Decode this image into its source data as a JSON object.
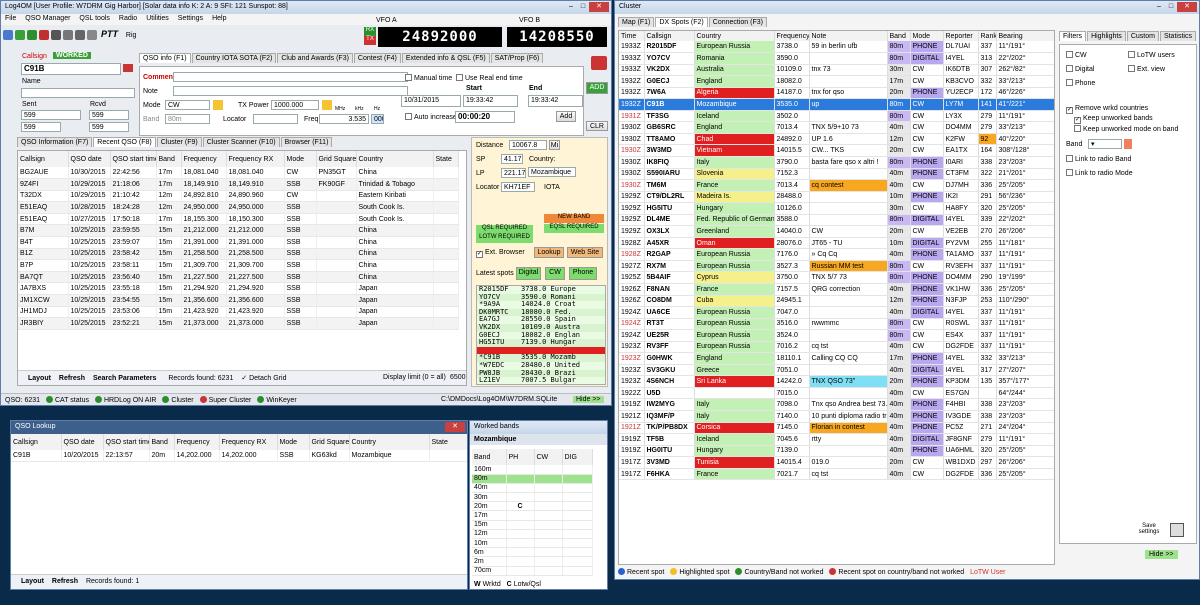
{
  "log4om": {
    "title": "Log4OM [User Profile: W7DRM Gig Harbor] [Solar data info K: 2 A: 9 SFI: 121 Sunspot: 88]",
    "menu": [
      "File",
      "QSO Manager",
      "QSL tools",
      "Radio",
      "Utilities",
      "Settings",
      "Help"
    ],
    "ptt": "PTT",
    "rig_label": "Rig",
    "vfo_a_label": "VFO A",
    "vfo_a_value": "24892000",
    "rx": "RX",
    "tx": "TX",
    "vfo_b_label": "VFO B",
    "vfo_b_value": "14208550",
    "callsign_label": "Callsign",
    "worked": "WORKED",
    "callsign_value": "C91B",
    "name_label": "Name",
    "sent_label": "Sent",
    "rcvd_label": "Rcvd",
    "sent_value": "599",
    "rcvd_value": "599",
    "sent_sel": "599",
    "rcvd_sel": "599",
    "tabs": [
      "QSO info (F1)",
      "Country IOTA SOTA (F2)",
      "Club and Awards (F3)",
      "Contest (F4)",
      "Extended info & QSL (F5)",
      "SAT/Prop (F6)"
    ],
    "comment_label": "Comment",
    "note_label": "Note",
    "mode_label": "Mode",
    "mode_value": "CW",
    "band_label": "Band",
    "band_value": "80m",
    "txpower_label": "TX Power",
    "txpower_value": "1000.000",
    "locator_label": "Locator",
    "freq_label": "Freq",
    "mhz": "MHz",
    "khz": "kHz",
    "hz": "Hz",
    "freq_mhz": "3.535",
    "freq_hz": "000",
    "manual_time": "Manual time",
    "use_real_time": "Use Real end time",
    "auto_increase": "Auto increase",
    "start": "Start",
    "end": "End",
    "date": "10/31/2015",
    "start_time": "19:33:42",
    "end_time": "19:33:42",
    "duration": "00:00:20",
    "add": "ADD",
    "add2": "Add",
    "clr": "CLR",
    "bottom_tabs": [
      "QSO Information (F7)",
      "Recent QSO (F8)",
      "Cluster (F9)",
      "Cluster Scanner (F10)",
      "Browser (F11)"
    ],
    "grid_headers": [
      "Callsign",
      "QSO date",
      "QSO start time",
      "Band",
      "Frequency",
      "Frequency RX",
      "Mode",
      "Grid Square",
      "Country",
      "State"
    ],
    "rows": [
      [
        "BG2AUE",
        "10/30/2015",
        "22:42:56",
        "17m",
        "18,081.040",
        "18,081.040",
        "CW",
        "PN35GT",
        "China",
        ""
      ],
      [
        "9Z4FI",
        "10/29/2015",
        "21:18:06",
        "17m",
        "18,149.910",
        "18,149.910",
        "SSB",
        "FK90GF",
        "Trinidad & Tobago",
        ""
      ],
      [
        "T32DX",
        "10/29/2015",
        "21:10:42",
        "12m",
        "24,892.810",
        "24,890.960",
        "CW",
        "",
        "Eastern Kiribati",
        ""
      ],
      [
        "E51EAQ",
        "10/28/2015",
        "18:24:28",
        "12m",
        "24,950.000",
        "24,950.000",
        "SSB",
        "",
        "South Cook Is.",
        ""
      ],
      [
        "E51EAQ",
        "10/27/2015",
        "17:50:18",
        "17m",
        "18,155.300",
        "18,150.300",
        "SSB",
        "",
        "South Cook Is.",
        ""
      ],
      [
        "B7M",
        "10/25/2015",
        "23:59:55",
        "15m",
        "21,212.000",
        "21,212.000",
        "SSB",
        "",
        "China",
        ""
      ],
      [
        "B4T",
        "10/25/2015",
        "23:59:07",
        "15m",
        "21,391.000",
        "21,391.000",
        "SSB",
        "",
        "China",
        ""
      ],
      [
        "B1Z",
        "10/25/2015",
        "23:58:42",
        "15m",
        "21,258.500",
        "21,258.500",
        "SSB",
        "",
        "China",
        ""
      ],
      [
        "B7P",
        "10/25/2015",
        "23:58:11",
        "15m",
        "21,309.700",
        "21,309.700",
        "SSB",
        "",
        "China",
        ""
      ],
      [
        "BA7QT",
        "10/25/2015",
        "23:56:40",
        "15m",
        "21,227.500",
        "21,227.500",
        "SSB",
        "",
        "China",
        ""
      ],
      [
        "JA7BXS",
        "10/25/2015",
        "23:55:18",
        "15m",
        "21,294.920",
        "21,294.920",
        "SSB",
        "",
        "Japan",
        ""
      ],
      [
        "JM1XCW",
        "10/25/2015",
        "23:54:55",
        "15m",
        "21,356.600",
        "21,356.600",
        "SSB",
        "",
        "Japan",
        ""
      ],
      [
        "JH1MDJ",
        "10/25/2015",
        "23:53:06",
        "15m",
        "21,423.920",
        "21,423.920",
        "SSB",
        "",
        "Japan",
        ""
      ],
      [
        "JR3BIY",
        "10/25/2015",
        "23:52:21",
        "15m",
        "21,373.000",
        "21,373.000",
        "SSB",
        "",
        "Japan",
        ""
      ]
    ],
    "footer": {
      "layout": "Layout",
      "refresh": "Refresh",
      "search": "Search Parameters",
      "records": "Records found:",
      "count": "6231",
      "detach": "Detach Grid",
      "display": "Display limit (0 = all)",
      "limit": "6500"
    },
    "info": {
      "distance_label": "Distance",
      "distance": "10067.8",
      "mi": "Mi",
      "sp_label": "SP",
      "sp": "41.17",
      "country_label": "Country:",
      "lp_label": "LP",
      "lp": "221.17",
      "country": "Mozambique",
      "locator_label": "Locator",
      "locator": "KH71EF",
      "iota": "IOTA"
    },
    "new_band": "NEW BAND",
    "eqsl_required": "EQSL REQUIRED",
    "qsl_required": "QSL REQUIRED",
    "lotw_required": "LOTW REQUIRED",
    "lookup": "Lookup",
    "website": "Web Site",
    "ext_browser": "Ext. Browser",
    "latest_spots": "Latest spots",
    "digital": "Digital",
    "cw": "CW",
    "phone": "Phone",
    "spot_list": [
      [
        "R2015DF",
        "3738.0 Europe"
      ],
      [
        "YO7CV",
        "3590.0 Romani"
      ],
      [
        "*9A9A",
        "14024.0 Croat"
      ],
      [
        "DK0MRTC",
        "18080.0 Fed."
      ],
      [
        "EA7GJ",
        "28550.0 Spain"
      ],
      [
        "VK2DX",
        "10109.0 Austra"
      ],
      [
        "G0ECJ",
        "18082.0 Englan"
      ],
      [
        "HG5ITU",
        "7139.0 Hungar"
      ],
      [
        "",
        "",
        "red"
      ],
      [
        "*C91B",
        "3535.0 Mozamb"
      ],
      [
        "*W7EDC",
        "28480.0 United"
      ],
      [
        "PW8JB",
        "28430.0 Brazi"
      ],
      [
        "LZ1EV",
        "7007.5 Bulgar"
      ]
    ],
    "status": {
      "qso": "QSO:",
      "qso_count": "6231",
      "cat": "CAT status",
      "hrd": "HRDLog ON AIR",
      "cluster": "Cluster",
      "super": "Super Cluster",
      "winkeyer": "WinKeyer",
      "path": "C:\\DMDocs\\Log4OM\\W7DRM.SQLite",
      "hide": "Hide >>"
    }
  },
  "lookup": {
    "title": "QSO Lookup",
    "headers": [
      "Callsign",
      "QSO date",
      "QSO start time",
      "Band",
      "Frequency",
      "Frequency RX",
      "Mode",
      "Grid Square",
      "Country",
      "State"
    ],
    "row": [
      "C91B",
      "10/20/2015",
      "22:13:57",
      "20m",
      "14,202.000",
      "14,202.000",
      "SSB",
      "KG63kd",
      "Mozambique",
      ""
    ],
    "layout": "Layout",
    "refresh": "Refresh",
    "records": "Records found:",
    "count": "1"
  },
  "worked": {
    "title": "Worked bands",
    "country": "Mozambique",
    "headers": [
      "Band",
      "PH",
      "CW",
      "DIG"
    ],
    "rows": [
      [
        "160m",
        "",
        "",
        ""
      ],
      [
        "80m",
        "",
        "",
        ""
      ],
      [
        "40m",
        "",
        "",
        ""
      ],
      [
        "30m",
        "",
        "",
        ""
      ],
      [
        "20m",
        "C",
        "",
        ""
      ],
      [
        "17m",
        "",
        "",
        ""
      ],
      [
        "15m",
        "",
        "",
        ""
      ],
      [
        "12m",
        "",
        "",
        ""
      ],
      [
        "10m",
        "",
        "",
        ""
      ],
      [
        "6m",
        "",
        "",
        ""
      ],
      [
        "2m",
        "",
        "",
        ""
      ],
      [
        "70cm",
        "",
        "",
        ""
      ]
    ],
    "legend_w": "W",
    "legend_w_text": "Wrktd",
    "legend_c": "C",
    "legend_c_text": "Lotw/Qsl"
  },
  "cluster": {
    "title": "Cluster",
    "tabs": [
      "Map (F1)",
      "DX Spots (F2)",
      "Connection (F3)"
    ],
    "right_tabs": [
      "Filters",
      "Highlights",
      "Custom",
      "Statistics"
    ],
    "headers": [
      "Time",
      "Callsign",
      "Country",
      "Frequency",
      "Note",
      "Band",
      "Mode",
      "Reporter",
      "Rank",
      "Bearing"
    ],
    "spots": [
      [
        "1933Z",
        "R2015DF",
        "European Russia",
        "3738.0",
        "59 in berlin ufb",
        "80m",
        "PHONE",
        "DL7UAI",
        "337",
        "11°/191°"
      ],
      [
        "1933Z",
        "YO7CV",
        "Romania",
        "3590.0",
        "",
        "80m",
        "DIGITAL",
        "I4YEL",
        "313",
        "22°/202°"
      ],
      [
        "1933Z",
        "VK2DX",
        "Australia",
        "10109.0",
        "tnx 73",
        "30m",
        "CW",
        "IK6DTB",
        "307",
        "262°/82°"
      ],
      [
        "1932Z",
        "G0ECJ",
        "England",
        "18082.0",
        "",
        "17m",
        "CW",
        "KB3CVO",
        "332",
        "33°/213°"
      ],
      [
        "1932Z",
        "7W6A",
        "Algeria",
        "14187.0",
        "tnx for qso",
        "20m",
        "PHONE",
        "YU2ECP",
        "172",
        "46°/226°"
      ],
      [
        "1932Z",
        "C91B",
        "Mozambique",
        "3535.0",
        "up",
        "80m",
        "CW",
        "LY7M",
        "141",
        "41°/221°"
      ],
      [
        "1931Z",
        "TF3SG",
        "Iceland",
        "3502.0",
        "",
        "80m",
        "CW",
        "LY3X",
        "279",
        "11°/191°"
      ],
      [
        "1930Z",
        "GB6SRC",
        "England",
        "7013.4",
        "TNX 5/9+10 73",
        "40m",
        "CW",
        "DO4MM",
        "279",
        "33°/213°"
      ],
      [
        "1930Z",
        "TT8AMO",
        "Chad",
        "24892.0",
        "UP 1.6",
        "12m",
        "CW",
        "K2FW",
        "92",
        "40°/220°"
      ],
      [
        "1930Z",
        "3W3MD",
        "Vietnam",
        "14015.5",
        "CW... TKS",
        "20m",
        "CW",
        "EA1TX",
        "164",
        "308°/128°"
      ],
      [
        "1930Z",
        "IK8FIQ",
        "Italy",
        "3790.0",
        "basta fare qso x altri !",
        "80m",
        "PHONE",
        "I0ARI",
        "338",
        "23°/203°"
      ],
      [
        "1930Z",
        "S590IARU",
        "Slovenia",
        "7152.3",
        "",
        "40m",
        "PHONE",
        "CT3FM",
        "322",
        "21°/201°"
      ],
      [
        "1930Z",
        "TM6M",
        "France",
        "7013.4",
        "cq contest",
        "40m",
        "CW",
        "DJ7MH",
        "336",
        "25°/205°"
      ],
      [
        "1929Z",
        "CT9/DL2RL",
        "Madeira Is.",
        "28488.0",
        "",
        "10m",
        "PHONE",
        "IK2I",
        "291",
        "56°/236°"
      ],
      [
        "1929Z",
        "HG5ITU",
        "Hungary",
        "10126.0",
        "",
        "30m",
        "CW",
        "HA8FY",
        "320",
        "25°/205°"
      ],
      [
        "1929Z",
        "DL4ME",
        "Fed. Republic of Germany",
        "3588.0",
        "",
        "80m",
        "DIGITAL",
        "I4YEL",
        "339",
        "22°/202°"
      ],
      [
        "1929Z",
        "OX3LX",
        "Greenland",
        "14040.0",
        "CW",
        "20m",
        "CW",
        "VE2EB",
        "270",
        "26°/206°"
      ],
      [
        "1928Z",
        "A45XR",
        "Oman",
        "28076.0",
        "JT65 - TU",
        "10m",
        "DIGITAL",
        "PY2VM",
        "255",
        "11°/181°"
      ],
      [
        "1928Z",
        "R2GAP",
        "European Russia",
        "7176.0",
        "» Cq Cq",
        "40m",
        "PHONE",
        "TA1AMO",
        "337",
        "11°/191°"
      ],
      [
        "1927Z",
        "RX7M",
        "European Russia",
        "3527.3",
        "Russian MM test",
        "80m",
        "CW",
        "RV3EFH",
        "337",
        "11°/191°"
      ],
      [
        "1925Z",
        "5B4AIF",
        "Cyprus",
        "3750.0",
        "TNX 5/7 73",
        "80m",
        "PHONE",
        "DO4MM",
        "290",
        "19°/199°"
      ],
      [
        "1926Z",
        "F8NAN",
        "France",
        "7157.5",
        "QRG correction",
        "40m",
        "PHONE",
        "VK1HW",
        "336",
        "25°/205°"
      ],
      [
        "1926Z",
        "CO8DM",
        "Cuba",
        "24945.1",
        "",
        "12m",
        "PHONE",
        "N3FJP",
        "253",
        "110°/290°"
      ],
      [
        "1924Z",
        "UA6CE",
        "European Russia",
        "7047.0",
        "",
        "40m",
        "DIGITAL",
        "I4YEL",
        "337",
        "11°/191°"
      ],
      [
        "1924Z",
        "RT3T",
        "European Russia",
        "3516.0",
        "rwwmmc",
        "80m",
        "CW",
        "R0SWL",
        "337",
        "11°/191°"
      ],
      [
        "1924Z",
        "UE25R",
        "European Russia",
        "3524.0",
        "",
        "80m",
        "CW",
        "ES4X",
        "337",
        "11°/191°"
      ],
      [
        "1923Z",
        "RV3FF",
        "European Russia",
        "7016.2",
        "cq tst",
        "40m",
        "CW",
        "DG2FDE",
        "337",
        "11°/191°"
      ],
      [
        "1923Z",
        "G0HWK",
        "England",
        "18110.1",
        "Calling CQ CQ",
        "17m",
        "PHONE",
        "I4YEL",
        "332",
        "33°/213°"
      ],
      [
        "1923Z",
        "SV3GKU",
        "Greece",
        "7051.0",
        "",
        "40m",
        "DIGITAL",
        "I4YEL",
        "317",
        "27°/207°"
      ],
      [
        "1923Z",
        "4S6NCH",
        "Sri Lanka",
        "14242.0",
        "TNX QSO 73\"",
        "20m",
        "PHONE",
        "KP3DM",
        "135",
        "357°/177°"
      ],
      [
        "1922Z",
        "U5D",
        "",
        "7015.0",
        "",
        "40m",
        "CW",
        "ES7GN",
        "",
        "64°/244°"
      ],
      [
        "1919Z",
        "IW2MYG",
        "Italy",
        "7098.0",
        "Tnx qso Andrea best 73...",
        "40m",
        "PHONE",
        "F4HBI",
        "338",
        "23°/203°"
      ],
      [
        "1921Z",
        "IQ3MF/P",
        "Italy",
        "7140.0",
        "10 punti diploma radio tr...",
        "40m",
        "PHONE",
        "IV3GDE",
        "338",
        "23°/203°"
      ],
      [
        "1921Z",
        "TK/P/PB8DX",
        "Corsica",
        "7145.0",
        "Florian in contest",
        "40m",
        "PHONE",
        "PC5Z",
        "271",
        "24°/204°"
      ],
      [
        "1919Z",
        "TF5B",
        "Iceland",
        "7045.6",
        "rtty",
        "40m",
        "DIGITAL",
        "JF8GNF",
        "279",
        "11°/191°"
      ],
      [
        "1919Z",
        "HG0ITU",
        "Hungary",
        "7139.0",
        "",
        "40m",
        "PHONE",
        "UA6HML",
        "320",
        "25°/205°"
      ],
      [
        "1917Z",
        "3V3MD",
        "Tunisia",
        "14015.4",
        "019.0",
        "20m",
        "CW",
        "WB1DXD",
        "297",
        "26°/206°"
      ],
      [
        "1917Z",
        "F6HKA",
        "France",
        "7021.7",
        "cq tst",
        "40m",
        "CW",
        "DG2FDE",
        "336",
        "25°/205°"
      ]
    ],
    "filters": {
      "cw": "CW",
      "lotw_users": "LoTW users",
      "digital": "Digital",
      "ext_view": "Ext. view",
      "phone": "Phone",
      "remove": "Remove wrkd countries",
      "keep_bands": "Keep unworked bands",
      "keep_mode": "Keep unworked mode on band",
      "band_label": "Band",
      "link_band": "Link to radio Band",
      "link_mode": "Link to radio Mode",
      "save": "Save settings"
    },
    "legend": {
      "recent": "Recent spot",
      "highlighted": "Highlighted spot",
      "not_worked": "Country/Band not worked",
      "recent_not_worked": "Recent spot on country/band not worked",
      "lotw": "LoTW User"
    },
    "hide": "Hide >>"
  }
}
